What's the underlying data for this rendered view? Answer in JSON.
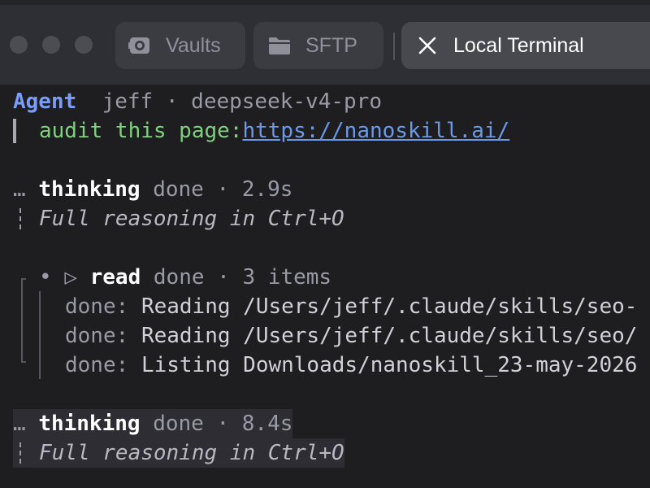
{
  "window": {
    "tabs": [
      {
        "label": "Vaults",
        "icon": "vault-icon",
        "active": false
      },
      {
        "label": "SFTP",
        "icon": "folder-icon",
        "active": false
      },
      {
        "label": "Local Terminal",
        "icon": "close-icon",
        "active": true
      }
    ]
  },
  "terminal": {
    "header": {
      "agent_label": "Agent",
      "meta": "jeff · deepseek-v4-pro"
    },
    "prompt": {
      "text": "audit this page:",
      "url": "https://nanoskill.ai/"
    },
    "thinking_1": {
      "ellipsis": "…",
      "label": "thinking",
      "status": "done · 2.9s",
      "hint": "Full reasoning in Ctrl+O"
    },
    "read_group": {
      "bullet": "•",
      "arrow": "▷",
      "label": "read",
      "status": "done · 3 items",
      "items": [
        {
          "status": "done:",
          "text": "Reading /Users/jeff/.claude/skills/seo-"
        },
        {
          "status": "done:",
          "text": "Reading /Users/jeff/.claude/skills/seo/"
        },
        {
          "status": "done:",
          "text": "Listing Downloads/nanoskill_23-may-2026"
        }
      ]
    },
    "thinking_2": {
      "ellipsis": "…",
      "label": "thinking",
      "status": "done · 8.4s",
      "hint": "Full reasoning in Ctrl+O"
    }
  },
  "colors": {
    "agent": "#7b9df7",
    "prompt_green": "#7fd17f",
    "link": "#6b99e8",
    "muted": "#9a9aa6"
  }
}
